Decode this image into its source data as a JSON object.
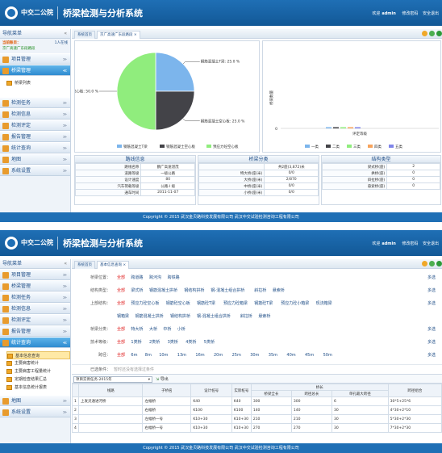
{
  "header": {
    "org": "中交二公院",
    "title": "桥梁检测与分析系统",
    "welcome": "欢迎",
    "user": "admin",
    "change_pwd": "修改密码",
    "logout": "安全退出"
  },
  "footer": "Copyright © 2015 武汉金贝路科技发展有限公司 武汉中交试验检测咨询工程有限公司",
  "sidebar": {
    "heading": "导航菜单",
    "account_label": "当前账目：",
    "online": "1人在线",
    "highway": "京广高速广东段路段"
  },
  "screen1": {
    "menu": [
      {
        "label": "项目管理",
        "chev": "≫"
      },
      {
        "label": "桥梁管理",
        "chev": "≫"
      },
      {
        "label": "检测任务",
        "chev": "≫"
      },
      {
        "label": "检测信息",
        "chev": "≫"
      },
      {
        "label": "检测评定",
        "chev": "≫"
      },
      {
        "label": "报告管理",
        "chev": "≫"
      },
      {
        "label": "统计查询",
        "chev": "≫"
      },
      {
        "label": "地图",
        "chev": "≫"
      },
      {
        "label": "系统设置",
        "chev": "≫"
      }
    ],
    "sub_item": "桥梁列表",
    "tabs": [
      "系统首页",
      "京广高速广东段路段 ×"
    ],
    "pie": {
      "slices": [
        {
          "label": "钢筋混凝土T梁",
          "pct": "25.0 %",
          "value": 25,
          "color": "#7cb5ec"
        },
        {
          "label": "钢筋混凝土空心板",
          "pct": "25.0 %",
          "value": 25,
          "color": "#434348"
        },
        {
          "label": "预应力砼空心板",
          "pct": "50.0 %",
          "value": 50,
          "color": "#90ed7d"
        }
      ],
      "legend": [
        "钢筋混凝土T梁",
        "钢筋混凝土空心板",
        "预应力砼空心板"
      ]
    },
    "bar": {
      "ylabel": "桥梁数量",
      "xlabel": "评定等级",
      "ytick": "0",
      "legend": [
        {
          "label": "一类",
          "color": "#7cb5ec"
        },
        {
          "label": "二类",
          "color": "#434348"
        },
        {
          "label": "三类",
          "color": "#90ed7d"
        },
        {
          "label": "四类",
          "color": "#f7a35c"
        },
        {
          "label": "五类",
          "color": "#8085e9"
        }
      ]
    },
    "route_info": {
      "title": "路线信息",
      "rows": [
        {
          "k": "路线名称",
          "v": "鹏广高速湛茂"
        },
        {
          "k": "道路等级",
          "v": "一级公路"
        },
        {
          "k": "设计速度",
          "v": "80"
        },
        {
          "k": "汽车荷载等级",
          "v": "公路-I 级"
        },
        {
          "k": "通车时间",
          "v": "2011-11-07"
        }
      ]
    },
    "bridge_class": {
      "title": "桥梁分类",
      "rows": [
        {
          "k": "",
          "v": "共2座(3,872)米"
        },
        {
          "k": "特大桥(座/米)",
          "v": "0/0"
        },
        {
          "k": "大桥(座/米)",
          "v": "2/870"
        },
        {
          "k": "中桥(座/米)",
          "v": "0/0"
        },
        {
          "k": "小桥(座/米)",
          "v": "0/0"
        }
      ]
    },
    "struct_type": {
      "title": "结构类型",
      "rows": [
        {
          "k": "梁式桥(座)",
          "v": "2"
        },
        {
          "k": "拱桥(座)",
          "v": "0"
        },
        {
          "k": "斜拉桥(座)",
          "v": "0"
        },
        {
          "k": "悬索桥(座)",
          "v": "0"
        }
      ]
    }
  },
  "screen2": {
    "menu_top": [
      {
        "label": "项目管理"
      },
      {
        "label": "桥梁管理"
      },
      {
        "label": "检测任务"
      },
      {
        "label": "检测信息"
      },
      {
        "label": "检测评定"
      },
      {
        "label": "报告管理"
      },
      {
        "label": "统计查询"
      }
    ],
    "sub_items": [
      "基本信息查询",
      "主要病害统计",
      "主要病害工程量统计",
      "定期检查结果汇总",
      "基本信息统计报表"
    ],
    "menu_bottom": [
      {
        "label": "地图"
      },
      {
        "label": "系统设置"
      }
    ],
    "tabs": [
      "系统首页",
      "基本信息查询 ×"
    ],
    "filters": [
      {
        "label": "桥梁位置：",
        "opts": [
          "全部",
          "跨道路",
          "跨河沟",
          "跨铁路"
        ]
      },
      {
        "label": "结构类型：",
        "opts": [
          "全部",
          "梁式桥",
          "钢筋混凝土拱桥",
          "钢结构拱桥",
          "钢-混凝土组合拱桥",
          "斜拉桥",
          "悬索桥"
        ]
      },
      {
        "label": "上部结构：",
        "opts": [
          "全部",
          "预应力砼空心板",
          "钢筋砼空心板",
          "钢筋砼T梁",
          "预应力砼箱梁",
          "钢筋砼T梁",
          "预应力砼小箱梁",
          "现浇箱梁"
        ]
      },
      {
        "label": "",
        "opts": [
          "钢箱梁",
          "钢筋混凝土拱桥",
          "钢结构拱桥",
          "钢-混凝土组合拱桥",
          "斜拉桥",
          "悬索桥"
        ]
      },
      {
        "label": "桥梁分类：",
        "opts": [
          "全部",
          "特大桥",
          "大桥",
          "中桥",
          "小桥"
        ]
      },
      {
        "label": "技术等级：",
        "opts": [
          "全部",
          "1类桥",
          "2类桥",
          "3类桥",
          "4类桥",
          "5类桥"
        ]
      },
      {
        "label": "跨径：",
        "opts": [
          "全部",
          "6m",
          "8m",
          "10m",
          "13m",
          "16m",
          "20m",
          "25m",
          "30m",
          "35m",
          "40m",
          "45m",
          "50m"
        ]
      }
    ],
    "more": "多选",
    "selected_label": "已选条件：",
    "selected_value": "暂时还没有选择过条件",
    "project_select": "项目实例任务-2015年",
    "export": "导出",
    "table": {
      "headers": [
        "线路",
        "子桥名",
        "设计桩号",
        "实际桩号",
        "桥长",
        "跨径组合"
      ],
      "subheaders": [
        "桥梁全长",
        "跨径总长",
        "单孔最大跨径"
      ],
      "rows": [
        {
          "n": "1",
          "route": "上发灵通进河桥",
          "name": "左幅桥",
          "design": "K40",
          "actual": "K40",
          "len": "300",
          "span": "300",
          "max": "6",
          "combo": "30*5+25*6"
        },
        {
          "n": "2",
          "route": "",
          "name": "右幅桥",
          "design": "K100",
          "actual": "K100",
          "len": "140",
          "span": "140",
          "max": "30",
          "combo": "4*30+2*10"
        },
        {
          "n": "3",
          "route": "",
          "name": "左幅桥一号",
          "design": "K10+30",
          "actual": "K10+30",
          "len": "210",
          "span": "210",
          "max": "30",
          "combo": "5*30+2*30"
        },
        {
          "n": "4",
          "route": "",
          "name": "右幅桥一号",
          "design": "K10+30",
          "actual": "K10+30",
          "len": "270",
          "span": "270",
          "max": "30",
          "combo": "7*30+2*30"
        }
      ]
    }
  }
}
